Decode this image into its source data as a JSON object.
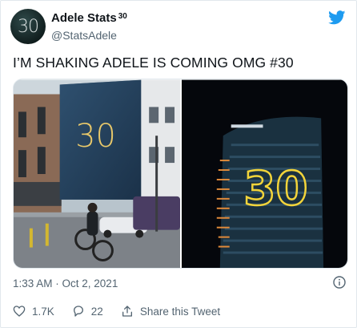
{
  "author": {
    "display_name": "Adele Stats",
    "badge": "30",
    "handle": "@StatsAdele",
    "avatar_text": "30"
  },
  "tweet": {
    "text": "I’M SHAKING ADELE IS COMING OMG #30",
    "timestamp": "1:33 AM · Oct 2, 2021"
  },
  "media": {
    "left_number": "30",
    "right_number": "30"
  },
  "actions": {
    "likes": "1.7K",
    "replies": "22",
    "share_label": "Share this Tweet"
  },
  "colors": {
    "twitter_blue": "#1d9bf0",
    "secondary_text": "#536471"
  },
  "icons": [
    "twitter-bird-icon",
    "info-icon",
    "heart-icon",
    "reply-icon",
    "share-icon"
  ]
}
